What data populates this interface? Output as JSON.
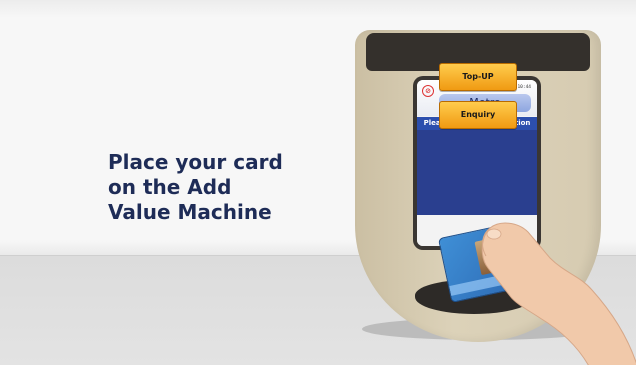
{
  "headline": {
    "line1": "Place your card",
    "line2": "on the Add",
    "line3": "Value Machine"
  },
  "screen": {
    "datetime": "08/11/2016 15:10:44",
    "title": "Metro",
    "prompt": "Please Select an Operation",
    "buttons": [
      {
        "label": "Top-UP"
      },
      {
        "label": "Enquiry"
      }
    ]
  },
  "colors": {
    "headline": "#1e2c57",
    "prompt_bar": "#2c4fae",
    "button": "#f5a623",
    "machine_body": "#d6cbb1",
    "card": "#2d6bb5"
  }
}
